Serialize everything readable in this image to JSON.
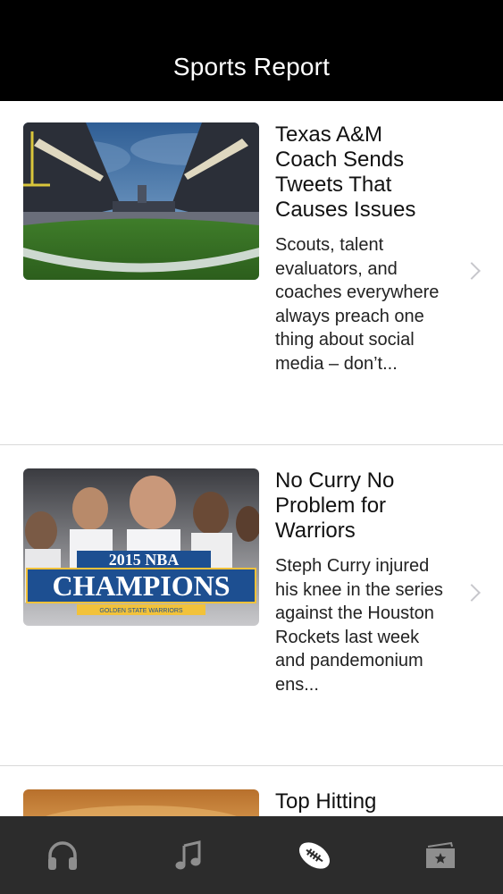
{
  "header": {
    "title": "Sports Report"
  },
  "articles": [
    {
      "headline": "Texas A&M Coach Sends Tweets That Causes Issues",
      "snippet": "Scouts, talent evaluators, and coaches everywhere always preach one thing about social media – don’t...",
      "image": "stadium-photo"
    },
    {
      "headline": "No Curry No Problem for Warriors",
      "snippet": "Steph Curry injured his knee in the series against the Houston Rockets last week and pandemonium ens...",
      "image": "champions-photo",
      "image_text": {
        "year_line": "2015 NBA",
        "main": "CHAMPIONS",
        "sub": "GOLDEN STATE WARRIORS"
      }
    },
    {
      "headline": "Top Hitting",
      "snippet": "",
      "image": "baseball-photo"
    }
  ],
  "tabbar": {
    "tabs": [
      {
        "icon": "headphones-icon",
        "active": false
      },
      {
        "icon": "music-note-icon",
        "active": false
      },
      {
        "icon": "football-icon",
        "active": true
      },
      {
        "icon": "ticket-star-icon",
        "active": false
      }
    ]
  },
  "colors": {
    "header_bg": "#000000",
    "tabbar_bg": "#2c2c2c",
    "tab_inactive": "#8e8e8e",
    "tab_active": "#ffffff"
  }
}
